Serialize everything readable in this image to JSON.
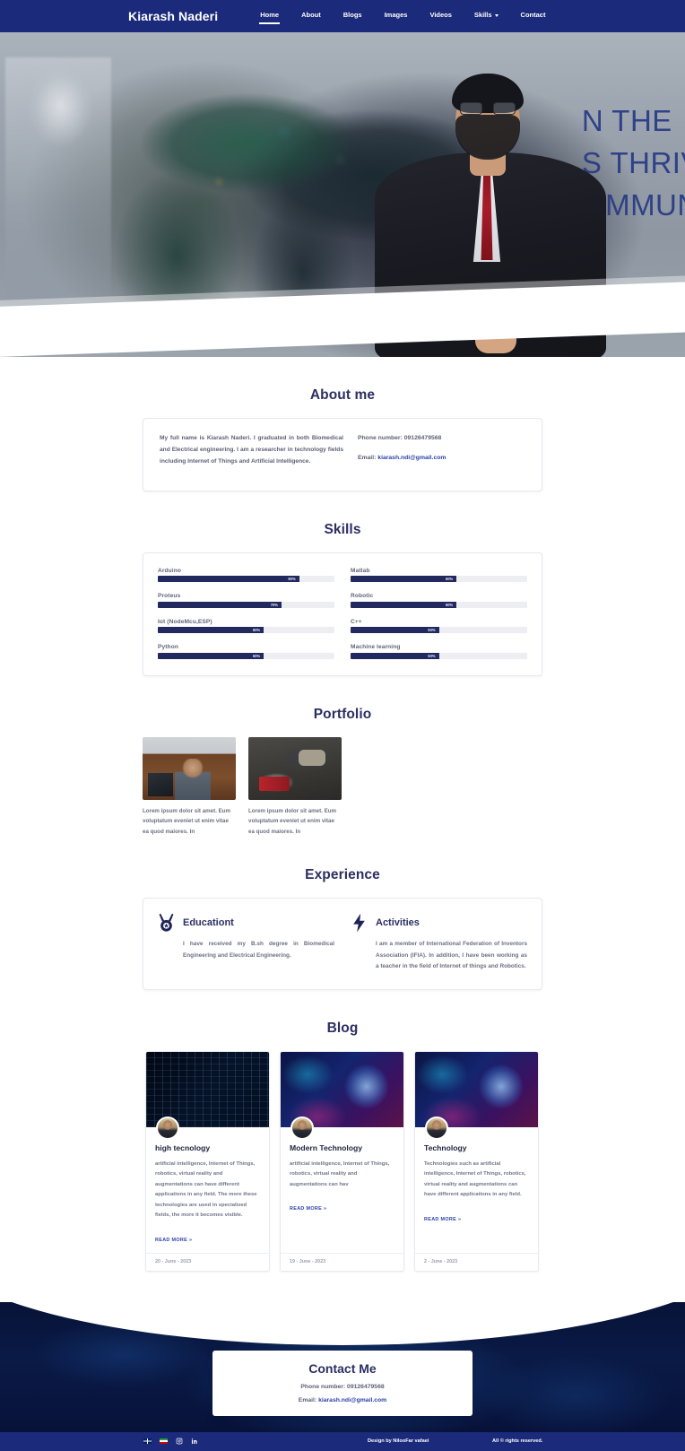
{
  "navbar": {
    "brand": "Kiarash Naderi",
    "items": [
      {
        "label": "Home",
        "active": true,
        "caret": false
      },
      {
        "label": "About",
        "active": false,
        "caret": false
      },
      {
        "label": "Blogs",
        "active": false,
        "caret": false
      },
      {
        "label": "Images",
        "active": false,
        "caret": false
      },
      {
        "label": "Videos",
        "active": false,
        "caret": false
      },
      {
        "label": "Skills",
        "active": false,
        "caret": true
      },
      {
        "label": "Contact",
        "active": false,
        "caret": false
      }
    ]
  },
  "hero": {
    "background_text_line1": "N THE",
    "background_text_line2": "S THRIV",
    "background_text_line3": "OMMUN"
  },
  "about": {
    "title": "About me",
    "bio": "My full name is Kiarash Naderi. I graduated in both Biomedical and Electrical engineering. I am a researcher in technology fields including Internet of Things and Artificial Intelligence.",
    "phone_label": "Phone number: 09126479568",
    "email_label": "Email:",
    "email": "kiarash.ndi@gmail.com"
  },
  "skills": {
    "title": "Skills",
    "left": [
      {
        "name": "Arduino",
        "percent": "80%",
        "value": 80
      },
      {
        "name": "Proteus",
        "percent": "70%",
        "value": 70
      },
      {
        "name": "Iot (NodeMcu,ESP)",
        "percent": "60%",
        "value": 60
      },
      {
        "name": "Python",
        "percent": "60%",
        "value": 60
      }
    ],
    "right": [
      {
        "name": "Matlab",
        "percent": "60%",
        "value": 60
      },
      {
        "name": "Robotic",
        "percent": "60%",
        "value": 60
      },
      {
        "name": "C++",
        "percent": "50%",
        "value": 50
      },
      {
        "name": "Machine learning",
        "percent": "50%",
        "value": 50
      }
    ]
  },
  "portfolio": {
    "title": "Portfolio",
    "items": [
      {
        "caption": "Lorem ipsum dolor sit amet. Eum voluptatum eveniet ut enim vitae ea quod maiores. In"
      },
      {
        "caption": "Lorem ipsum dolor sit amet. Eum voluptatum eveniet ut enim vitae ea quod maiores. In"
      }
    ]
  },
  "experience": {
    "title": "Experience",
    "items": [
      {
        "icon": "medal-icon",
        "title": "Educationt",
        "text": "I have received my B.sh degree in Biomedical Engineering and Electrical Engineering."
      },
      {
        "icon": "lightning-bolt-icon",
        "title": "Activities",
        "text": "I am a member of International Federation of Inventors Association (IFIA). In addition, I have been working as a teacher in the field of Internet of things and Robotics."
      }
    ]
  },
  "blog": {
    "title": "Blog",
    "read_more_label": "READ MORE »",
    "posts": [
      {
        "image": "circuit-board-image",
        "title": "high tecnology",
        "excerpt": "artificial intelligence, Internet of Things, robotics, virtual reality and augmentations can have different applications in any field. The more these technologies are used in specialized fields, the more it becomes visible.",
        "date": "20 - June - 2023"
      },
      {
        "image": "digital-globe-image",
        "title": "Modern Technology",
        "excerpt": "artificial intelligence, Internet of Things, robotics, virtual reality and augmentations can hav",
        "date": "19 - June - 2023"
      },
      {
        "image": "digital-globe-image",
        "title": "Technology",
        "excerpt": "Technologies such as artificial intelligence, Internet of Things, robotics, virtual reality and augmentations can have different applications in any field.",
        "date": "2 - June - 2023"
      }
    ]
  },
  "contact": {
    "title": "Contact Me",
    "phone_label": "Phone number: 09126479568",
    "email_label": "Email:",
    "email": "kiarash.ndi@gmail.com"
  },
  "footer": {
    "social": [
      {
        "name": "flag-uk-icon"
      },
      {
        "name": "flag-iran-icon"
      },
      {
        "name": "instagram-icon"
      },
      {
        "name": "linkedin-icon"
      }
    ],
    "credit": "Design by NilooFar vafaei",
    "rights": "All © rights reserved."
  },
  "colors": {
    "navy": "#1b2a7a",
    "heading": "#2b2f62",
    "link": "#2b3fa8",
    "skill_fill": "#22295e",
    "skill_track": "#eceef1",
    "body_text": "#6b7183"
  }
}
